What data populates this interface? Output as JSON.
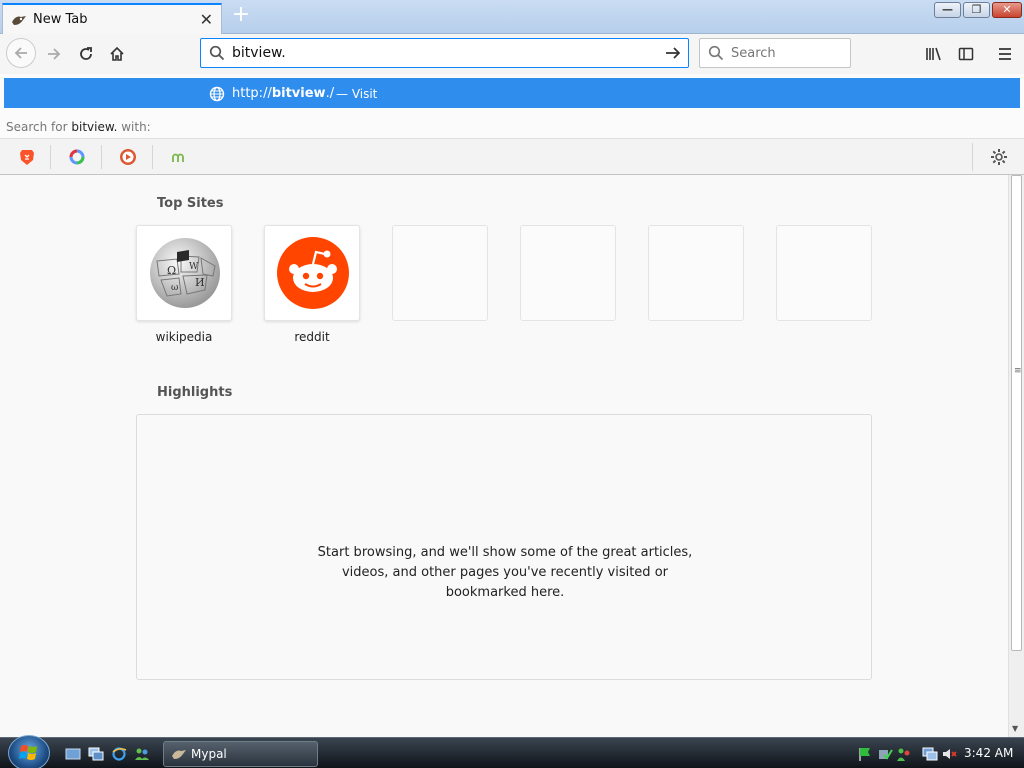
{
  "window": {
    "tab_title": "New Tab",
    "new_tab_symbol": "+",
    "controls": {
      "minimize": "—",
      "maximize": "❐",
      "close": "✕"
    }
  },
  "toolbar": {
    "url_value": "bitview.",
    "search_placeholder": "Search"
  },
  "dropdown": {
    "suggestion_prefix": "http://",
    "suggestion_host": "bitview",
    "suggestion_suffix": "./",
    "suggestion_action": "— Visit",
    "search_with_prefix": "Search for",
    "search_with_query": "bitview.",
    "search_with_suffix": "with:",
    "engines": [
      "brave-icon",
      "qwant-icon",
      "duckduckgo-icon",
      "mojeek-icon"
    ]
  },
  "top_sites": {
    "title": "Top Sites",
    "sites": [
      {
        "label": "wikipedia",
        "icon": "wikipedia-icon"
      },
      {
        "label": "reddit",
        "icon": "reddit-icon"
      },
      {
        "label": "",
        "icon": ""
      },
      {
        "label": "",
        "icon": ""
      },
      {
        "label": "",
        "icon": ""
      },
      {
        "label": "",
        "icon": ""
      }
    ]
  },
  "highlights": {
    "title": "Highlights",
    "line1": "Start browsing, and we'll show some of the great articles,",
    "line2": "videos, and other pages you've recently visited or",
    "line3": "bookmarked here."
  },
  "taskbar": {
    "task_label": "Mypal",
    "clock": "3:42 AM"
  },
  "colors": {
    "accent": "#0a84ff",
    "suggestion_bg": "#2f8dee",
    "reddit": "#ff4500"
  }
}
